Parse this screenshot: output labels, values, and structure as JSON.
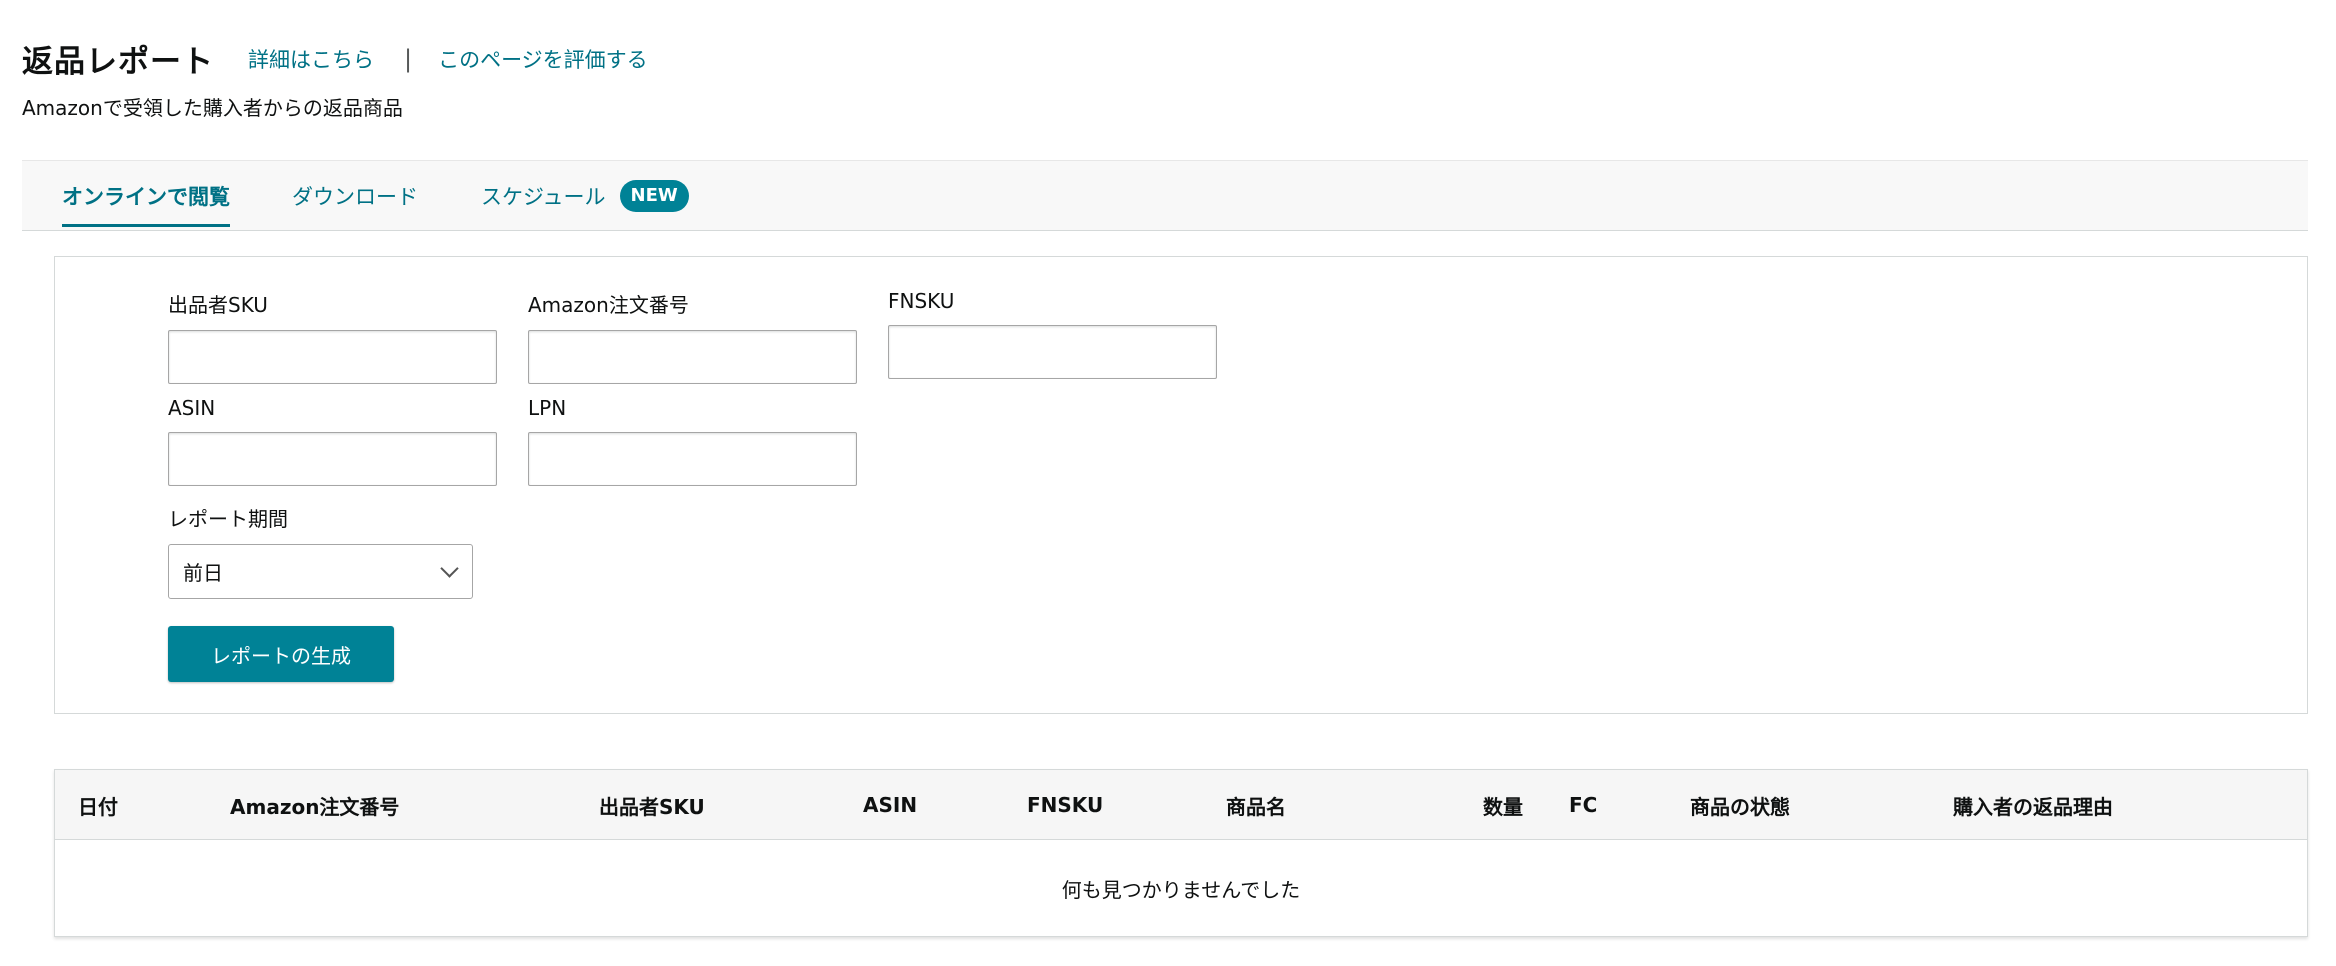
{
  "header": {
    "title": "返品レポート",
    "details_link": "詳細はこちら",
    "separator": "|",
    "rate_link": "このページを評価する",
    "subtitle": "Amazonで受領した購入者からの返品商品"
  },
  "tabs": {
    "online": "オンラインで閲覧",
    "download": "ダウンロード",
    "schedule": "スケジュール",
    "new_badge": "NEW",
    "active": "online"
  },
  "filters": {
    "seller_sku": {
      "label": "出品者SKU",
      "value": ""
    },
    "order_id": {
      "label": "Amazon注文番号",
      "value": ""
    },
    "fnsku": {
      "label": "FNSKU",
      "value": ""
    },
    "asin": {
      "label": "ASIN",
      "value": ""
    },
    "lpn": {
      "label": "LPN",
      "value": ""
    },
    "period": {
      "label": "レポート期間",
      "selected": "前日"
    },
    "generate_button": "レポートの生成"
  },
  "table": {
    "columns": [
      "日付",
      "Amazon注文番号",
      "出品者SKU",
      "ASIN",
      "FNSKU",
      "商品名",
      "数量",
      "FC",
      "商品の状態",
      "購入者の返品理由"
    ],
    "empty_message": "何も見つかりませんでした"
  },
  "colors": {
    "accent": "#007185",
    "button": "#008296",
    "badge": "#008296"
  }
}
